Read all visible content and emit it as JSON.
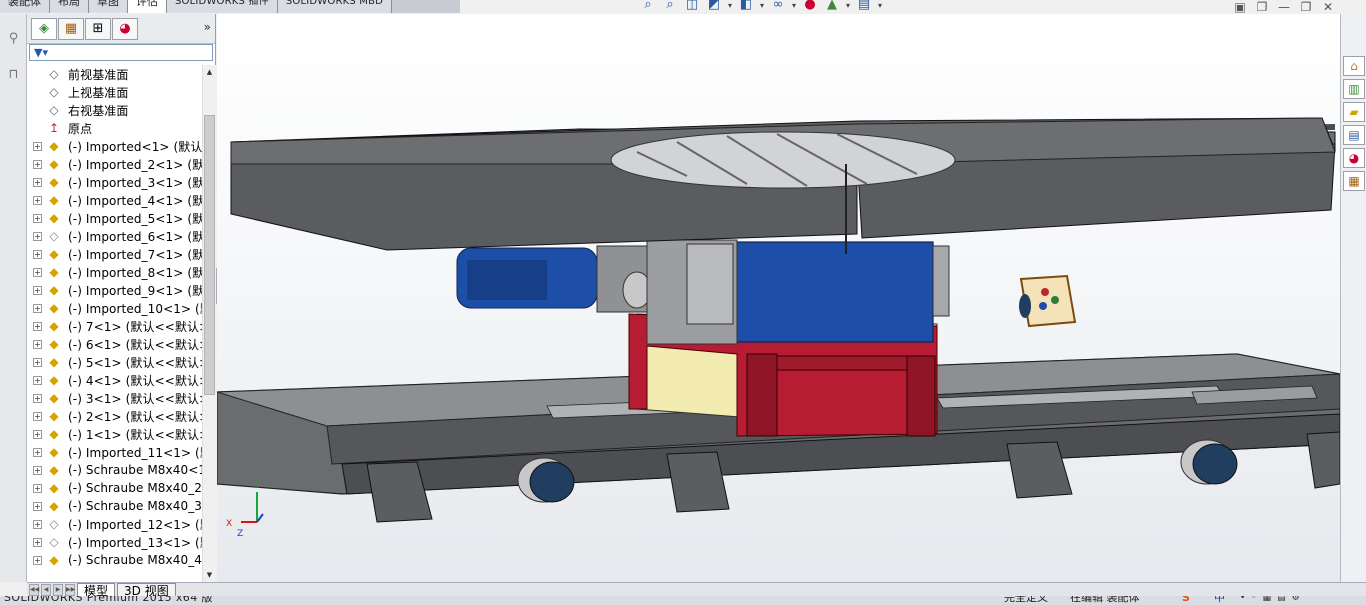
{
  "top_tabs": [
    {
      "label": "装配体",
      "active": false
    },
    {
      "label": "布局",
      "active": false
    },
    {
      "label": "草图",
      "active": false
    },
    {
      "label": "评估",
      "active": true
    },
    {
      "label": "SOLIDWORKS 插件",
      "active": false
    },
    {
      "label": "SOLIDWORKS MBD",
      "active": false
    }
  ],
  "hud_toolbar": [
    "zoom-to-fit-icon",
    "zoom-to-area-icon",
    "previous-view-icon",
    "section-view-icon",
    "view-orientation-icon",
    "display-style-icon",
    "hide-show-icon",
    "edit-appearance-icon",
    "apply-scene-icon",
    "view-settings-icon"
  ],
  "feature_tree": {
    "filter_symbol": "▼▾",
    "base_items": [
      {
        "label": "前视基准面",
        "icon": "plane-icon"
      },
      {
        "label": "上视基准面",
        "icon": "plane-icon"
      },
      {
        "label": "右视基准面",
        "icon": "plane-icon"
      },
      {
        "label": "原点",
        "icon": "origin-icon"
      }
    ],
    "components": [
      {
        "label": "(-) Imported<1> (默认",
        "icon": "part-icon"
      },
      {
        "label": "(-) Imported_2<1> (默认",
        "icon": "part-icon"
      },
      {
        "label": "(-) Imported_3<1> (默认",
        "icon": "part-icon"
      },
      {
        "label": "(-) Imported_4<1> (默认",
        "icon": "part-icon"
      },
      {
        "label": "(-) Imported_5<1> (默认",
        "icon": "part-icon"
      },
      {
        "label": "(-) Imported_6<1> (默认",
        "icon": "part-outline-icon"
      },
      {
        "label": "(-) Imported_7<1> (默认",
        "icon": "part-icon"
      },
      {
        "label": "(-) Imported_8<1> (默认",
        "icon": "part-icon"
      },
      {
        "label": "(-) Imported_9<1> (默认",
        "icon": "part-icon"
      },
      {
        "label": "(-) Imported_10<1> (默",
        "icon": "part-icon"
      },
      {
        "label": "(-) 7<1> (默认<<默认>",
        "icon": "part-icon"
      },
      {
        "label": "(-) 6<1> (默认<<默认>",
        "icon": "part-icon"
      },
      {
        "label": "(-) 5<1> (默认<<默认>",
        "icon": "part-icon"
      },
      {
        "label": "(-) 4<1> (默认<<默认>",
        "icon": "part-icon"
      },
      {
        "label": "(-) 3<1> (默认<<默认>",
        "icon": "part-icon"
      },
      {
        "label": "(-) 2<1> (默认<<默认>",
        "icon": "part-icon"
      },
      {
        "label": "(-) 1<1> (默认<<默认>",
        "icon": "part-icon"
      },
      {
        "label": "(-) Imported_11<1> (默",
        "icon": "part-icon"
      },
      {
        "label": "(-) Schraube M8x40<1",
        "icon": "part-icon"
      },
      {
        "label": "(-) Schraube M8x40_2<",
        "icon": "part-icon"
      },
      {
        "label": "(-) Schraube M8x40_3<",
        "icon": "part-icon"
      },
      {
        "label": "(-) Imported_12<1> (默",
        "icon": "part-outline-icon"
      },
      {
        "label": "(-) Imported_13<1> (默",
        "icon": "part-outline-icon"
      },
      {
        "label": "(-) Schraube M8x40_4",
        "icon": "part-icon"
      }
    ]
  },
  "bottom_tabs": [
    {
      "label": "模型",
      "active": true
    },
    {
      "label": "3D 视图",
      "active": false
    }
  ],
  "status_bar": {
    "app_version": "SOLIDWORKS Premium 2015 x64 版",
    "mode": "完全定义",
    "editing": "在编辑 装配体",
    "ime": "中"
  },
  "triad": {
    "x": "X",
    "y": "Y",
    "z": "Z"
  },
  "colors": {
    "table_gray": "#5f6165",
    "motor_blue": "#1e4fa8",
    "base_red": "#b81c32",
    "accent_yellow": "#f3ecb0"
  }
}
